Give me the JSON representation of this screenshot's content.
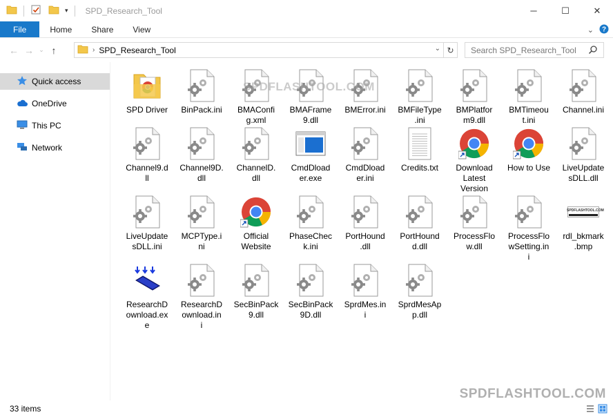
{
  "window": {
    "title": "SPD_Research_Tool",
    "minimize": "─",
    "maximize": "☐",
    "close": "✕"
  },
  "ribbon": {
    "tabs": [
      "File",
      "Home",
      "Share",
      "View"
    ]
  },
  "address": {
    "path": "SPD_Research_Tool",
    "search_placeholder": "Search SPD_Research_Tool"
  },
  "nav": {
    "items": [
      {
        "label": "Quick access",
        "icon": "star-icon"
      },
      {
        "label": "OneDrive",
        "icon": "cloud-icon"
      },
      {
        "label": "This PC",
        "icon": "computer-icon"
      },
      {
        "label": "Network",
        "icon": "network-icon"
      }
    ]
  },
  "files": [
    {
      "name": "SPD Driver",
      "type": "folder"
    },
    {
      "name": "BinPack.ini",
      "type": "settings"
    },
    {
      "name": "BMAConfig.xml",
      "type": "settings"
    },
    {
      "name": "BMAFrame9.dll",
      "type": "settings"
    },
    {
      "name": "BMError.ini",
      "type": "settings"
    },
    {
      "name": "BMFileType.ini",
      "type": "settings"
    },
    {
      "name": "BMPlatform9.dll",
      "type": "settings"
    },
    {
      "name": "BMTimeout.ini",
      "type": "settings"
    },
    {
      "name": "Channel.ini",
      "type": "settings"
    },
    {
      "name": "Channel9.dll",
      "type": "settings"
    },
    {
      "name": "Channel9D.dll",
      "type": "settings"
    },
    {
      "name": "ChannelD.dll",
      "type": "settings"
    },
    {
      "name": "CmdDloader.exe",
      "type": "window"
    },
    {
      "name": "CmdDloader.ini",
      "type": "settings"
    },
    {
      "name": "Credits.txt",
      "type": "text"
    },
    {
      "name": "Download Latest Version",
      "type": "chrome"
    },
    {
      "name": "How to Use",
      "type": "chrome"
    },
    {
      "name": "LiveUpdatesDLL.dll",
      "type": "settings"
    },
    {
      "name": "LiveUpdatesDLL.ini",
      "type": "settings"
    },
    {
      "name": "MCPType.ini",
      "type": "settings"
    },
    {
      "name": "Official Website",
      "type": "chrome"
    },
    {
      "name": "PhaseCheck.ini",
      "type": "settings"
    },
    {
      "name": "PortHound.dll",
      "type": "settings"
    },
    {
      "name": "PortHound.dll",
      "type": "settings"
    },
    {
      "name": "ProcessFlow.dll",
      "type": "settings"
    },
    {
      "name": "ProcessFlowSetting.ini",
      "type": "settings"
    },
    {
      "name": "rdl_bkmark.bmp",
      "type": "bmp"
    },
    {
      "name": "ResearchDownload.exe",
      "type": "research"
    },
    {
      "name": "ResearchDownload.ini",
      "type": "settings"
    },
    {
      "name": "SecBinPack9.dll",
      "type": "settings"
    },
    {
      "name": "SecBinPack9D.dll",
      "type": "settings"
    },
    {
      "name": "SprdMes.ini",
      "type": "settings"
    },
    {
      "name": "SprdMesApp.dll",
      "type": "settings"
    }
  ],
  "labels": [
    "SPD Driver",
    "BinPack.ini",
    "BMAConfi\ng.xml",
    "BMAFrame\n9.dll",
    "BMError.ini",
    "BMFileType\n.ini",
    "BMPlatfor\nm9.dll",
    "BMTimeou\nt.ini",
    "Channel.ini",
    "Channel9.d\nll",
    "Channel9D.\ndll",
    "ChannelD.\ndll",
    "CmdDload\ner.exe",
    "CmdDload\ner.ini",
    "Credits.txt",
    "Download\nLatest\nVersion",
    "How to Use",
    "LiveUpdate\nsDLL.dll",
    "LiveUpdate\nsDLL.ini",
    "MCPType.i\nni",
    "Official\nWebsite",
    "PhaseChec\nk.ini",
    "PortHound\n.dll",
    "PortHound\nd.dll",
    "ProcessFlo\nw.dll",
    "ProcessFlo\nwSetting.in\ni",
    "rdl_bkmark\n.bmp",
    "ResearchD\nownload.ex\ne",
    "ResearchD\nownload.in\ni",
    "SecBinPack\n9.dll",
    "SecBinPack\n9D.dll",
    "SprdMes.in\ni",
    "SprdMesAp\np.dll"
  ],
  "bmp_thumb_text": "SPDFLASHTOOL.COM",
  "watermark": "SPDFLASHTOOL.COM",
  "status": {
    "count": "33 items"
  },
  "colors": {
    "accent": "#1979ca",
    "folder": "#f3c74b",
    "selected": "#d9d9d9"
  }
}
